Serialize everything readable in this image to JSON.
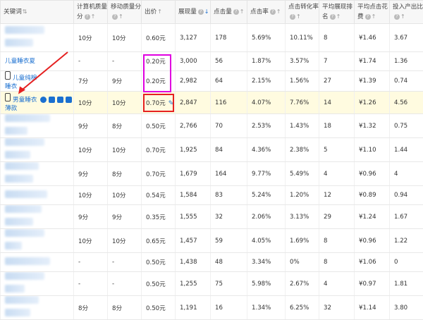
{
  "headers": [
    {
      "label": "关键词",
      "q": false,
      "sort": "updown"
    },
    {
      "label": "计算机质量分",
      "q": true,
      "sort": "up"
    },
    {
      "label": "移动质量分",
      "q": true,
      "sort": "up"
    },
    {
      "label": "出价",
      "q": false,
      "sort": "up"
    },
    {
      "label": "展现量",
      "q": true,
      "sort": "down-active"
    },
    {
      "label": "点击量",
      "q": true,
      "sort": "up"
    },
    {
      "label": "点击率",
      "q": true,
      "sort": "up"
    },
    {
      "label": "点击转化率",
      "q": true,
      "sort": "up"
    },
    {
      "label": "平均展现排名",
      "q": true,
      "sort": "up"
    },
    {
      "label": "平均点击花费",
      "q": true,
      "sort": "up"
    },
    {
      "label": "投入产出比",
      "q": true,
      "sort": "up"
    }
  ],
  "rows": [
    {
      "kw": "",
      "kw2": "",
      "blur": [
        70,
        50
      ],
      "mobile": false,
      "pc_q": "10分",
      "m_q": "10分",
      "bid": "0.60元",
      "imp": "3,127",
      "clk": "178",
      "ctr": "5.69%",
      "cvr": "10.11%",
      "rank": "8",
      "cpc": "¥1.46",
      "roi": "3.67"
    },
    {
      "kw": "儿童睡衣夏",
      "kw2": "",
      "blur": [],
      "mobile": false,
      "pc_q": "-",
      "m_q": "-",
      "bid": "0.20元",
      "imp": "3,000",
      "clk": "56",
      "ctr": "1.87%",
      "cvr": "3.57%",
      "rank": "7",
      "cpc": "¥1.74",
      "roi": "1.36"
    },
    {
      "kw": "儿童纯棉",
      "kw2": "睡衣",
      "blur": [],
      "mobile": true,
      "pc_q": "7分",
      "m_q": "9分",
      "bid": "0.20元",
      "imp": "2,982",
      "clk": "64",
      "ctr": "2.15%",
      "cvr": "1.56%",
      "rank": "27",
      "cpc": "¥1.39",
      "roi": "0.74"
    },
    {
      "kw": "男童睡衣",
      "kw2": "薄款",
      "blur": [],
      "mobile": true,
      "tools": true,
      "pc_q": "10分",
      "m_q": "10分",
      "bid": "0.70元",
      "imp": "2,847",
      "clk": "116",
      "ctr": "4.07%",
      "cvr": "7.76%",
      "rank": "14",
      "cpc": "¥1.26",
      "roi": "4.56"
    },
    {
      "kw": "",
      "kw2": "",
      "blur": [
        80,
        40
      ],
      "mobile": false,
      "pc_q": "9分",
      "m_q": "8分",
      "bid": "0.50元",
      "imp": "2,766",
      "clk": "70",
      "ctr": "2.53%",
      "cvr": "1.43%",
      "rank": "18",
      "cpc": "¥1.32",
      "roi": "0.75"
    },
    {
      "kw": "",
      "kw2": "",
      "blur": [
        70,
        45
      ],
      "mobile": false,
      "pc_q": "10分",
      "m_q": "10分",
      "bid": "0.70元",
      "imp": "1,925",
      "clk": "84",
      "ctr": "4.36%",
      "cvr": "2.38%",
      "rank": "5",
      "cpc": "¥1.10",
      "roi": "1.44"
    },
    {
      "kw": "",
      "kw2": "",
      "blur": [
        60,
        50
      ],
      "mobile": false,
      "pc_q": "9分",
      "m_q": "8分",
      "bid": "0.70元",
      "imp": "1,679",
      "clk": "164",
      "ctr": "9.77%",
      "cvr": "5.49%",
      "rank": "4",
      "cpc": "¥0.96",
      "roi": "4"
    },
    {
      "kw": "",
      "kw2": "",
      "blur": [
        75,
        0
      ],
      "mobile": false,
      "pc_q": "10分",
      "m_q": "10分",
      "bid": "0.54元",
      "imp": "1,584",
      "clk": "83",
      "ctr": "5.24%",
      "cvr": "1.20%",
      "rank": "12",
      "cpc": "¥0.89",
      "roi": "0.94"
    },
    {
      "kw": "",
      "kw2": "",
      "blur": [
        65,
        50
      ],
      "mobile": false,
      "pc_q": "9分",
      "m_q": "9分",
      "bid": "0.35元",
      "imp": "1,555",
      "clk": "32",
      "ctr": "2.06%",
      "cvr": "3.13%",
      "rank": "29",
      "cpc": "¥1.24",
      "roi": "1.67"
    },
    {
      "kw": "",
      "kw2": "",
      "blur": [
        70,
        30
      ],
      "mobile": false,
      "pc_q": "10分",
      "m_q": "10分",
      "bid": "0.65元",
      "imp": "1,457",
      "clk": "59",
      "ctr": "4.05%",
      "cvr": "1.69%",
      "rank": "8",
      "cpc": "¥0.96",
      "roi": "1.22"
    },
    {
      "kw": "",
      "kw2": "",
      "blur": [
        80,
        0
      ],
      "mobile": false,
      "pc_q": "-",
      "m_q": "-",
      "bid": "0.50元",
      "imp": "1,438",
      "clk": "48",
      "ctr": "3.34%",
      "cvr": "0%",
      "rank": "8",
      "cpc": "¥1.06",
      "roi": "0"
    },
    {
      "kw": "",
      "kw2": "",
      "blur": [
        70,
        35
      ],
      "mobile": false,
      "pc_q": "-",
      "m_q": "-",
      "bid": "0.50元",
      "imp": "1,255",
      "clk": "75",
      "ctr": "5.98%",
      "cvr": "2.67%",
      "rank": "4",
      "cpc": "¥0.97",
      "roi": "1.81"
    },
    {
      "kw": "",
      "kw2": "",
      "blur": [
        60,
        45
      ],
      "mobile": false,
      "pc_q": "8分",
      "m_q": "8分",
      "bid": "0.50元",
      "imp": "1,191",
      "clk": "16",
      "ctr": "1.34%",
      "cvr": "6.25%",
      "rank": "32",
      "cpc": "¥1.14",
      "roi": "3.80"
    }
  ],
  "colors": {
    "highlight_box": "#e000e0",
    "selected_box": "#e52020",
    "arrow": "#e52020",
    "link": "#1a6fd0",
    "row_highlight": "#fffbe0"
  }
}
